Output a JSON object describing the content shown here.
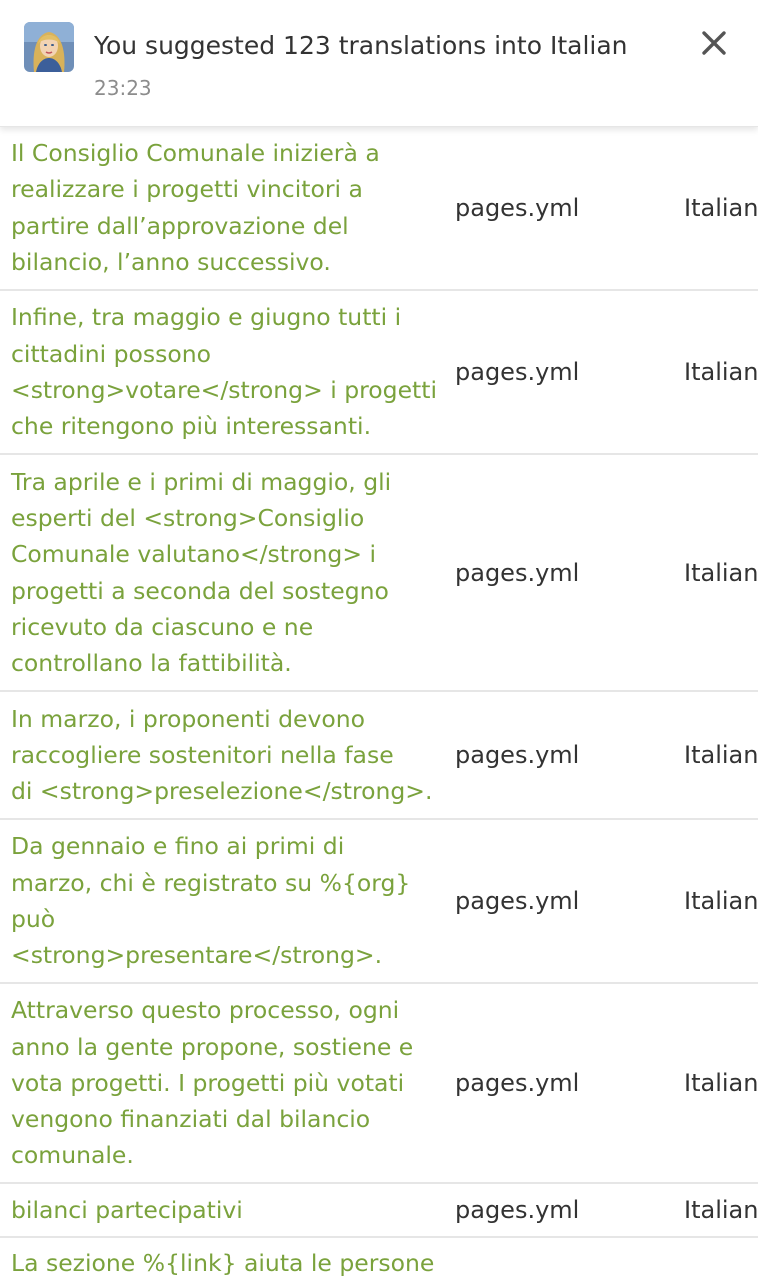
{
  "notification": {
    "title": "You suggested 123 translations into Italian",
    "time": "23:23"
  },
  "colors": {
    "suggestion_text": "#7aa23c",
    "body_text": "#333333",
    "divider": "#e6e6e6"
  },
  "rows": [
    {
      "text": "Il Consiglio Comunale inizierà a\nrealizzare i progetti vincitori a\npartire dall’approvazione del\nbilancio, l’anno successivo.",
      "file": "pages.yml",
      "language": "Italian"
    },
    {
      "text": "Infine, tra maggio e giugno tutti i\ncittadini possono\n<strong>votare</strong> i progetti\nche ritengono più interessanti.",
      "file": "pages.yml",
      "language": "Italian"
    },
    {
      "text": "Tra aprile e i primi di maggio, gli\nesperti del <strong>Consiglio\nComunale valutano</strong> i\nprogetti a seconda del sostegno\nricevuto da ciascuno e ne\ncontrollano la fattibilità.",
      "file": "pages.yml",
      "language": "Italian"
    },
    {
      "text": "In marzo, i proponenti devono\nraccogliere sostenitori nella fase\ndi <strong>preselezione</strong>.",
      "file": "pages.yml",
      "language": "Italian"
    },
    {
      "text": "Da gennaio e fino ai primi di\nmarzo, chi è registrato su %{org}\npuò\n<strong>presentare</strong>.",
      "file": "pages.yml",
      "language": "Italian"
    },
    {
      "text": "Attraverso questo processo, ogni\nanno la gente propone, sostiene e\nvota progetti. I progetti più votati\nvengono finanziati dal bilancio\ncomunale.",
      "file": "pages.yml",
      "language": "Italian"
    },
    {
      "text": "bilanci partecipativi",
      "file": "pages.yml",
      "language": "Italian"
    },
    {
      "text": "La sezione %{link} aiuta le persone",
      "file": "",
      "language": ""
    }
  ]
}
